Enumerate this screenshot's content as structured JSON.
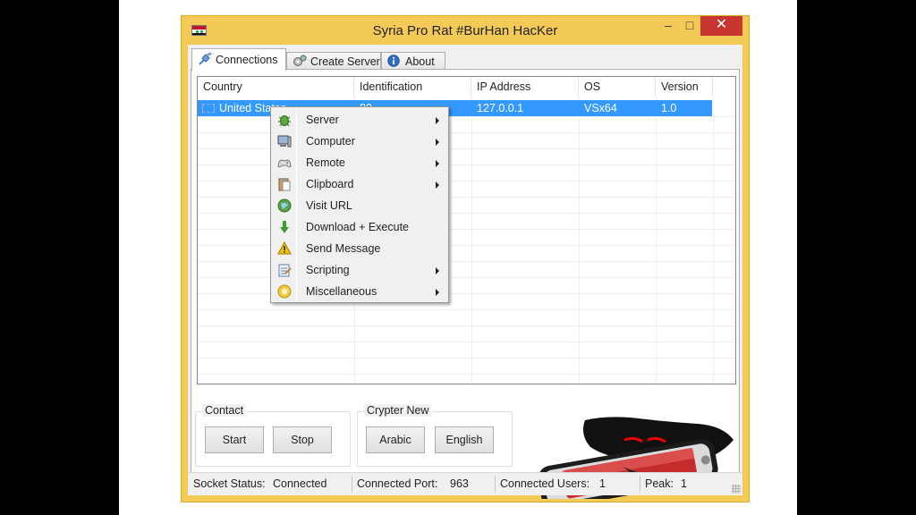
{
  "window": {
    "title": "Syria Pro Rat #BurHan HacKer",
    "minimize": "–",
    "maximize": "□",
    "close": "✕"
  },
  "tabs": [
    {
      "label": "Connections",
      "icon": "plug-icon",
      "active": true
    },
    {
      "label": "Create Server",
      "icon": "gears-icon",
      "active": false
    },
    {
      "label": "About",
      "icon": "info-icon",
      "active": false
    }
  ],
  "table": {
    "columns": [
      "Country",
      "Identification",
      "IP Address",
      "OS",
      "Version"
    ],
    "rows": [
      {
        "country": "United States",
        "identification": "80",
        "ip": "127.0.0.1",
        "os": "VSx64",
        "version": "1.0",
        "selected": true
      }
    ]
  },
  "context_menu": [
    {
      "label": "Server",
      "icon": "bug-icon",
      "submenu": true
    },
    {
      "label": "Computer",
      "icon": "computer-icon",
      "submenu": true
    },
    {
      "label": "Remote",
      "icon": "gamepad-icon",
      "submenu": true
    },
    {
      "label": "Clipboard",
      "icon": "clipboard-icon",
      "submenu": true
    },
    {
      "label": "Visit URL",
      "icon": "globe-icon",
      "submenu": false
    },
    {
      "label": "Download + Execute",
      "icon": "download-arrow-icon",
      "submenu": false
    },
    {
      "label": "Send Message",
      "icon": "warning-icon",
      "submenu": false
    },
    {
      "label": "Scripting",
      "icon": "script-icon",
      "submenu": true
    },
    {
      "label": "Miscellaneous",
      "icon": "smiley-icon",
      "submenu": true
    }
  ],
  "contact": {
    "title": "Contact",
    "start": "Start",
    "stop": "Stop"
  },
  "crypter": {
    "title": "Crypter New",
    "arabic": "Arabic",
    "english": "English"
  },
  "status": {
    "socket_label": "Socket Status:",
    "socket_value": "Connected",
    "port_label": "Connected Port:",
    "port_value": "963",
    "users_label": "Connected Users:",
    "users_value": "1",
    "peak_label": "Peak:",
    "peak_value": "1"
  },
  "colors": {
    "frame": "#f3ca56",
    "selection": "#3399ff",
    "close": "#c7372f"
  }
}
